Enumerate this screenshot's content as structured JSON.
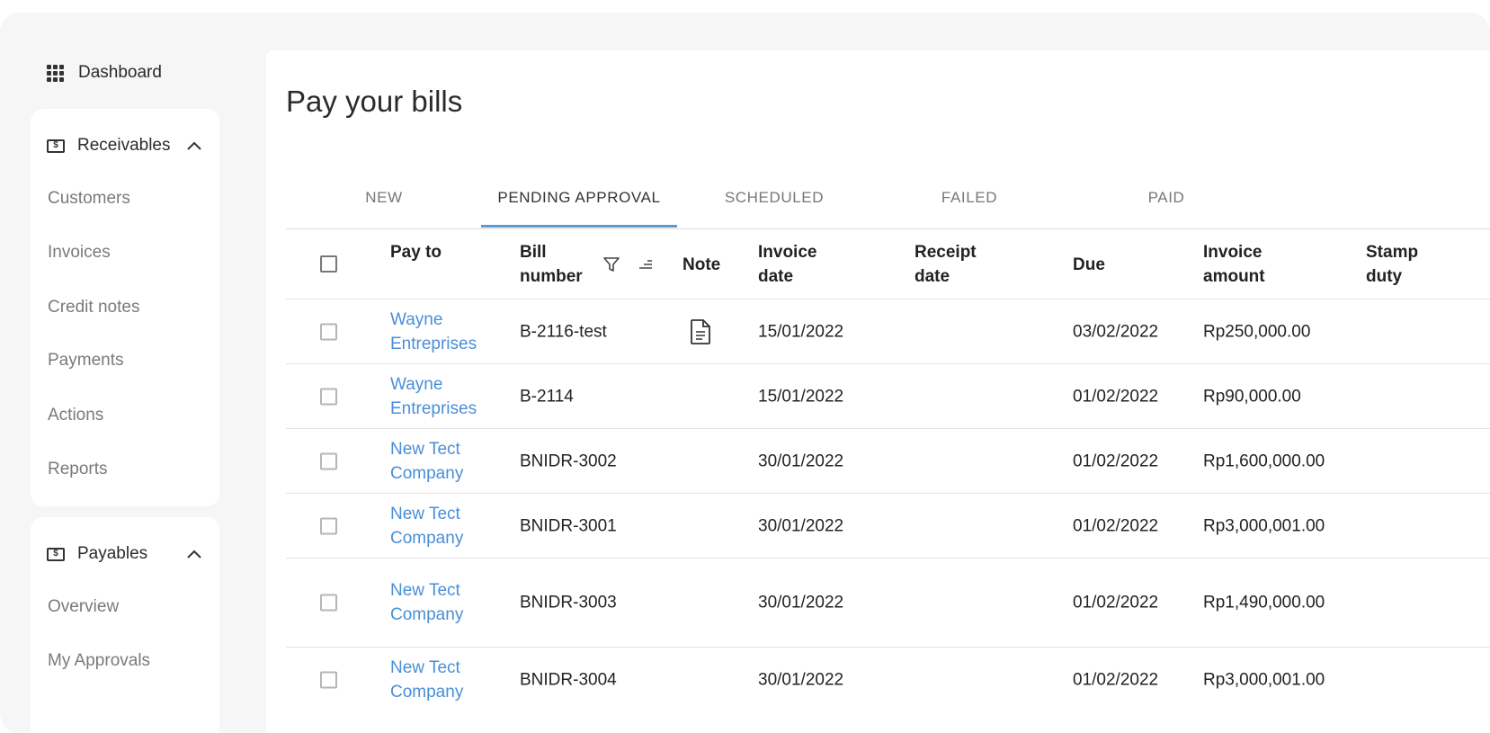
{
  "sidebar": {
    "dashboard_label": "Dashboard",
    "receivables": {
      "title": "Receivables",
      "items": [
        "Customers",
        "Invoices",
        "Credit notes",
        "Payments",
        "Actions",
        "Reports"
      ]
    },
    "payables": {
      "title": "Payables",
      "items": [
        "Overview",
        "My Approvals"
      ]
    }
  },
  "main": {
    "title": "Pay your bills",
    "tabs": [
      "NEW",
      "PENDING APPROVAL",
      "SCHEDULED",
      "FAILED",
      "PAID"
    ],
    "active_tab": "PENDING APPROVAL",
    "columns": {
      "pay_to": "Pay to",
      "bill_number": "Bill number",
      "note": "Note",
      "invoice_date": "Invoice date",
      "receipt_date": "Receipt date",
      "due": "Due",
      "invoice_amount": "Invoice amount",
      "stamp_duty": "Stamp duty"
    },
    "rows": [
      {
        "pay_to": "Wayne Entreprises",
        "bill_number": "B-2116-test",
        "has_note": true,
        "invoice_date": "15/01/2022",
        "receipt_date": "",
        "due": "03/02/2022",
        "invoice_amount": "Rp250,000.00"
      },
      {
        "pay_to": "Wayne Entreprises",
        "bill_number": "B-2114",
        "has_note": false,
        "invoice_date": "15/01/2022",
        "receipt_date": "",
        "due": "01/02/2022",
        "invoice_amount": "Rp90,000.00"
      },
      {
        "pay_to": "New Tect Company",
        "bill_number": "BNIDR-3002",
        "has_note": false,
        "invoice_date": "30/01/2022",
        "receipt_date": "",
        "due": "01/02/2022",
        "invoice_amount": "Rp1,600,000.00"
      },
      {
        "pay_to": "New Tect Company",
        "bill_number": "BNIDR-3001",
        "has_note": false,
        "invoice_date": "30/01/2022",
        "receipt_date": "",
        "due": "01/02/2022",
        "invoice_amount": "Rp3,000,001.00"
      },
      {
        "pay_to": "New Tect Company",
        "bill_number": "BNIDR-3003",
        "has_note": false,
        "invoice_date": "30/01/2022",
        "receipt_date": "",
        "due": "01/02/2022",
        "invoice_amount": "Rp1,490,000.00"
      },
      {
        "pay_to": "New Tect Company",
        "bill_number": "BNIDR-3004",
        "has_note": false,
        "invoice_date": "30/01/2022",
        "receipt_date": "",
        "due": "01/02/2022",
        "invoice_amount": "Rp3,000,001.00"
      }
    ]
  },
  "colors": {
    "link": "#4a8fd6",
    "active_tab_underline": "#5b9bd5",
    "background": "#f6f6f7"
  }
}
